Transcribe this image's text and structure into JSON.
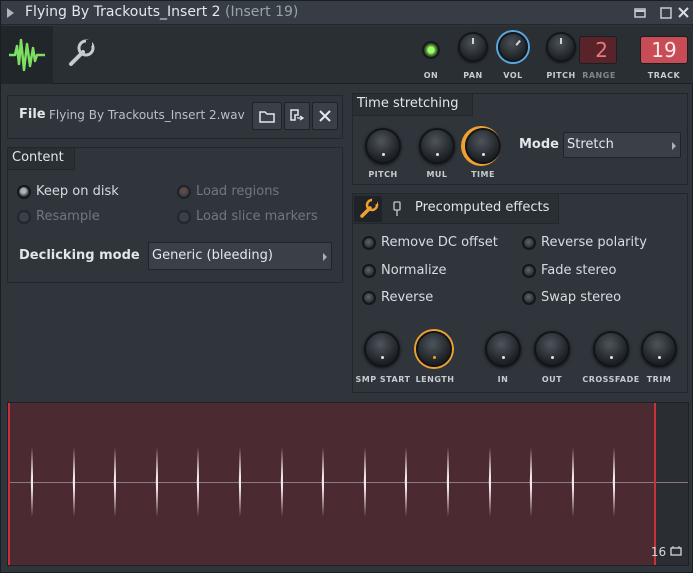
{
  "window": {
    "title": "Flying By Trackouts_Insert 2",
    "subtitle": "(Insert 19)"
  },
  "controls": {
    "on_label": "ON",
    "pan_label": "PAN",
    "vol_label": "VOL",
    "pitch_label": "PITCH",
    "range_label": "RANGE",
    "range_value": "2",
    "track_label": "TRACK",
    "track_value": "19"
  },
  "file": {
    "label": "File",
    "name": "Flying By Trackouts_Insert 2.wav"
  },
  "content": {
    "title": "Content",
    "options": [
      {
        "label": "Keep on disk",
        "state": "on"
      },
      {
        "label": "Load regions",
        "state": "disabled"
      },
      {
        "label": "Resample",
        "state": "disabled"
      },
      {
        "label": "Load slice markers",
        "state": "disabled"
      }
    ],
    "declicking_label": "Declicking mode",
    "declicking_value": "Generic (bleeding)"
  },
  "time_stretching": {
    "title": "Time stretching",
    "knobs": [
      "PITCH",
      "MUL",
      "TIME"
    ],
    "mode_label": "Mode",
    "mode_value": "Stretch"
  },
  "precomputed": {
    "title": "Precomputed effects",
    "options": [
      "Remove DC offset",
      "Reverse polarity",
      "Normalize",
      "Fade stereo",
      "Reverse",
      "Swap stereo"
    ],
    "knobs": [
      "SMP START",
      "LENGTH",
      "IN",
      "OUT",
      "CROSSFADE",
      "TRIM"
    ]
  },
  "waveform": {
    "loop_count": "16",
    "spike_count": 15
  },
  "colors": {
    "accent_green": "#7ee060",
    "accent_orange": "#f0a030",
    "accent_blue": "#5aa8e0",
    "marker_red": "#c8303a",
    "track_red": "#c84c56"
  }
}
